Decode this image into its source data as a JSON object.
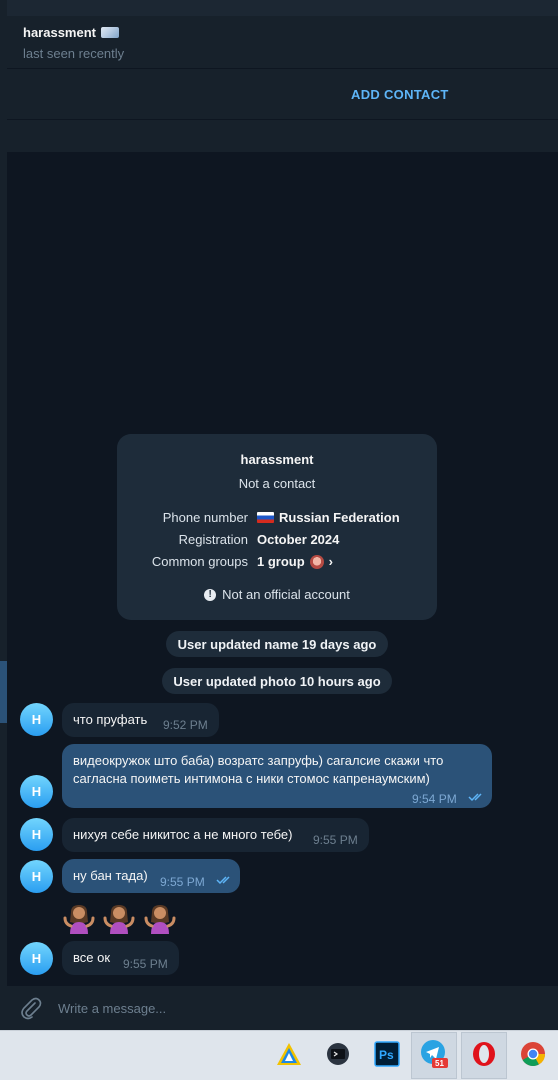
{
  "header": {
    "name": "harassment",
    "status": "last seen recently"
  },
  "add_contact_label": "ADD CONTACT",
  "info_card": {
    "name": "harassment",
    "subtitle": "Not a contact",
    "rows": [
      {
        "label": "Phone number",
        "value": "Russian Federation",
        "icon": "russia-flag-icon"
      },
      {
        "label": "Registration",
        "value": "October 2024"
      },
      {
        "label": "Common groups",
        "value": "1 group",
        "icon": "group-emoji-icon"
      }
    ],
    "official_note": "Not an official account"
  },
  "service_messages": [
    "User updated name 19 days ago",
    "User updated photo 10 hours ago"
  ],
  "messages": [
    {
      "direction": "in",
      "avatar_letter": "H",
      "text": "что пруфать",
      "time": "9:52 PM"
    },
    {
      "direction": "out",
      "avatar_letter": "H",
      "text_lines": [
        "видеокружок што баба) возратс запруфь) сагалсие скажи что",
        "сагласна поиметь интимона с ники стомос капренаумским)"
      ],
      "time": "9:54 PM",
      "read": true
    },
    {
      "direction": "in",
      "avatar_letter": "H",
      "text": "нихуя себе никитос а не много тебе)",
      "time": "9:55 PM"
    },
    {
      "direction": "out",
      "avatar_letter": "H",
      "text": "ну бан тада)",
      "time": "9:55 PM",
      "read": true
    },
    {
      "type": "sticker",
      "emoji": [
        "🤷‍♀️",
        "🤷‍♀️",
        "🤷‍♀️"
      ],
      "icon": "shrug-woman-emoji"
    },
    {
      "direction": "in",
      "avatar_letter": "H",
      "text": "все ок",
      "time": "9:55 PM"
    }
  ],
  "composer": {
    "placeholder": "Write a message..."
  },
  "taskbar": {
    "apps": [
      {
        "name": "aimp-icon"
      },
      {
        "name": "terminal-icon"
      },
      {
        "name": "photoshop-icon",
        "label": "Ps"
      },
      {
        "name": "telegram-icon",
        "badge": "51"
      },
      {
        "name": "opera-icon"
      },
      {
        "name": "chrome-icon"
      }
    ]
  },
  "colors": {
    "background": "#0e1621",
    "panel": "#17212b",
    "incoming_bubble": "#182533",
    "outgoing_bubble": "#2b5278",
    "accent": "#5eb5f7",
    "card": "#1e2c3a"
  }
}
